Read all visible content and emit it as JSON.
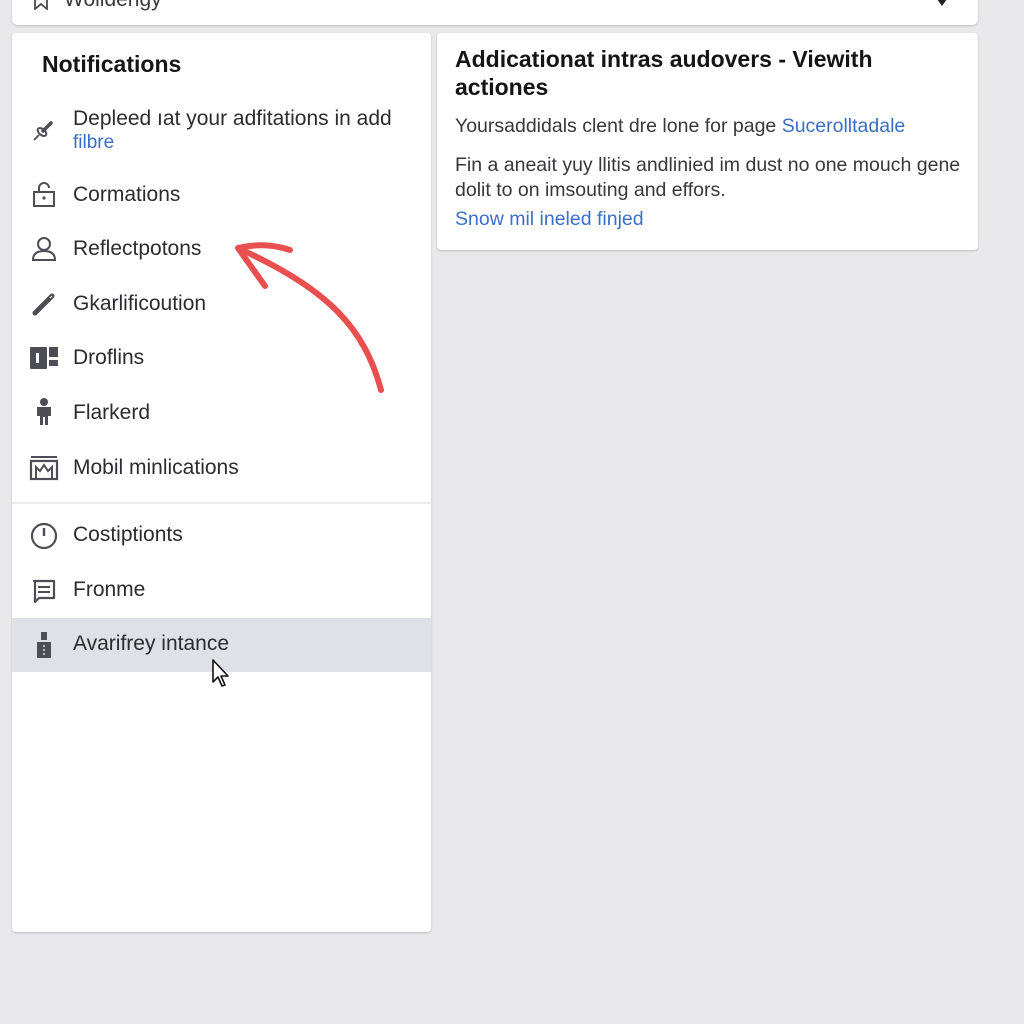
{
  "top_bar": {
    "title": "Wolldengy",
    "icon": "bookmark-icon",
    "caret_icon": "caret-down-icon"
  },
  "sidebar": {
    "title": "Notifications",
    "items": [
      {
        "label": "Depleed ıat your adfitations in add",
        "sublabel": "filbre",
        "icon": "pin-icon"
      },
      {
        "label": "Cormations",
        "icon": "lock-open-icon"
      },
      {
        "label": "Reflectpotons",
        "icon": "user-icon"
      },
      {
        "label": "Gkarlificoution",
        "icon": "pencil-icon"
      },
      {
        "label": "Droflins",
        "icon": "layout-icon"
      },
      {
        "label": "Flarkerd",
        "icon": "person-icon"
      },
      {
        "label": "Mobil minlications",
        "icon": "storefront-icon"
      }
    ],
    "items_secondary": [
      {
        "label": "Costiptionts",
        "icon": "power-icon"
      },
      {
        "label": "Fronme",
        "icon": "message-icon"
      },
      {
        "label": "Avarifrey intance",
        "icon": "bottle-icon",
        "active": true
      }
    ]
  },
  "card": {
    "title": "Addicationat intras audovers - Viewith actiones",
    "line1_text": "Yoursaddidals clent dre lone for page ",
    "line1_link": "Sucerolltadale",
    "paragraph": "Fin a aneait yuy llitis andlinied im dust no one mouch gene dolit to on imsouting and effors.",
    "more_link": "Snow mil ineled finjed"
  },
  "colors": {
    "accent_link": "#3b6fc6",
    "annotation_arrow": "#e8504f",
    "active_row": "#dfe1e7",
    "page_bg": "#e9e9ec"
  }
}
